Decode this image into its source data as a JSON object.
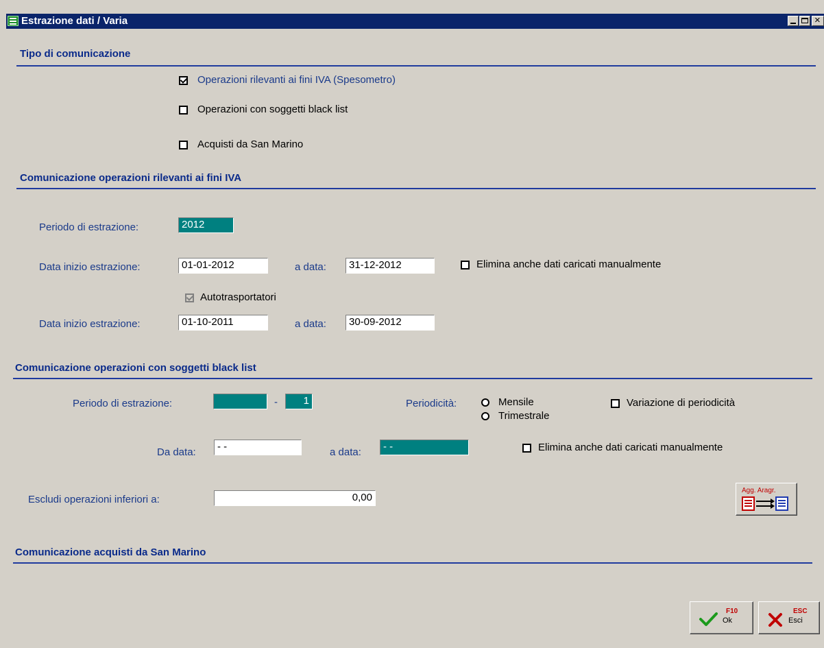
{
  "window": {
    "title": "Estrazione dati / Varia"
  },
  "tipo": {
    "title": "Tipo di comunicazione",
    "spesometro": {
      "label": "Operazioni rilevanti ai fini IVA (Spesometro)",
      "checked": true
    },
    "black_list": {
      "label": "Operazioni con soggetti black list",
      "checked": false
    },
    "san_marino": {
      "label": "Acquisti da San Marino",
      "checked": false
    }
  },
  "rilevanti": {
    "title": "Comunicazione operazioni rilevanti ai fini IVA",
    "periodo_label": "Periodo di estrazione:",
    "periodo_value": "2012",
    "data_inizio_label": "Data inizio estrazione:",
    "data_inizio_value": "01-01-2012",
    "a_data_label": "a data:",
    "a_data_value": "31-12-2012",
    "elimina_label": "Elimina anche dati caricati manualmente",
    "elimina_checked": false,
    "autotrasportatori_label": "Autotrasportatori",
    "autotrasportatori_checked": true,
    "data_inizio2_label": "Data inizio estrazione:",
    "data_inizio2_value": "01-10-2011",
    "a_data2_label": "a data:",
    "a_data2_value": "30-09-2012"
  },
  "blacklist": {
    "title": "Comunicazione operazioni con soggetti black list",
    "periodo_label": "Periodo di estrazione:",
    "periodo_value": "",
    "separator": "-",
    "periodo_num": "1",
    "periodicita_label": "Periodicità:",
    "mensile_label": "Mensile",
    "trimestrale_label": "Trimestrale",
    "variazione_label": "Variazione di periodicità",
    "variazione_checked": false,
    "da_data_label": "Da data:",
    "da_data_value": "- -",
    "a_data_label": "a data:",
    "a_data_value": "- -",
    "elimina_label": "Elimina anche dati caricati manualmente",
    "elimina_checked": false,
    "escludi_label": "Escludi operazioni inferiori a:",
    "escludi_value": "0,00",
    "agg_button_label": "Agg. Aragr."
  },
  "san_marino": {
    "title": "Comunicazione acquisti da San Marino"
  },
  "footer": {
    "ok_key": "F10",
    "ok_label": "Ok",
    "esci_key": "ESC",
    "esci_label": "Esci"
  },
  "colors": {
    "title_bar": "#0a246a",
    "section_title": "#0a2a8a",
    "field_teal": "#008080",
    "background": "#d4d0c8"
  }
}
